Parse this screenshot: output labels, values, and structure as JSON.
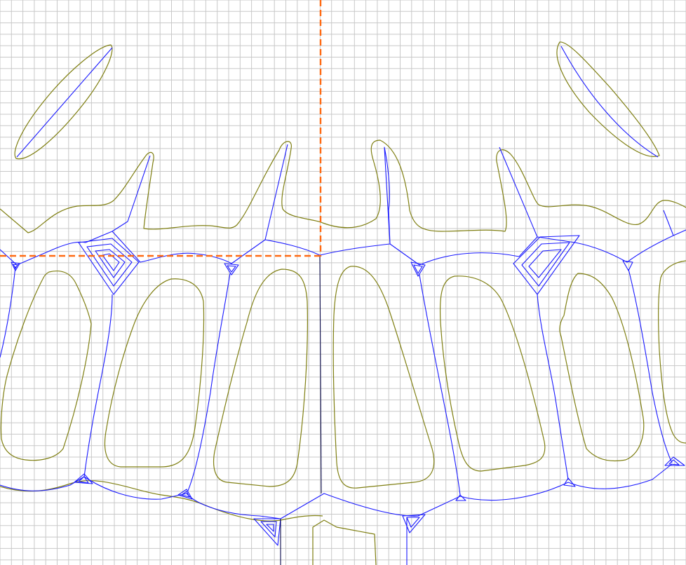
{
  "canvas": {
    "background": "#ffffff",
    "grid_color": "#c8c8c8",
    "offset_contour_color": "#7f7f12",
    "toolpath_color": "#1a1aff",
    "medial_axis_color": "#0a0a4a",
    "guide_color": "#ff6a13"
  },
  "guides": {
    "vertical_dashed": true,
    "horizontal_dashed": true
  }
}
